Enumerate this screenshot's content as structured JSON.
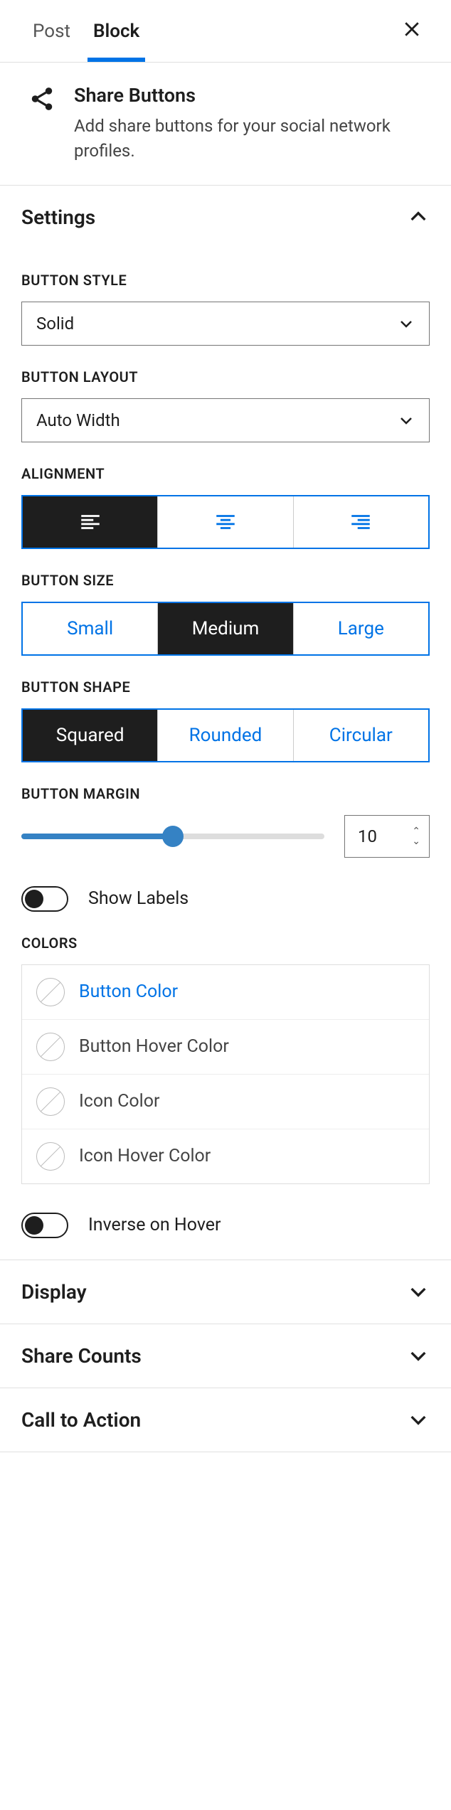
{
  "tabs": {
    "post": "Post",
    "block": "Block"
  },
  "block": {
    "title": "Share Buttons",
    "description": "Add share buttons for your social network profiles."
  },
  "panels": {
    "settings": "Settings",
    "display": "Display",
    "share_counts": "Share Counts",
    "cta": "Call to Action"
  },
  "settings": {
    "button_style": {
      "label": "BUTTON STYLE",
      "value": "Solid"
    },
    "button_layout": {
      "label": "BUTTON LAYOUT",
      "value": "Auto Width"
    },
    "alignment": {
      "label": "ALIGNMENT"
    },
    "button_size": {
      "label": "BUTTON SIZE",
      "options": [
        "Small",
        "Medium",
        "Large"
      ],
      "selected": "Medium"
    },
    "button_shape": {
      "label": "BUTTON SHAPE",
      "options": [
        "Squared",
        "Rounded",
        "Circular"
      ],
      "selected": "Squared"
    },
    "button_margin": {
      "label": "BUTTON MARGIN",
      "value": "10"
    },
    "show_labels": {
      "label": "Show Labels",
      "value": false
    },
    "colors": {
      "label": "COLORS",
      "items": [
        {
          "label": "Button Color",
          "active": true
        },
        {
          "label": "Button Hover Color",
          "active": false
        },
        {
          "label": "Icon Color",
          "active": false
        },
        {
          "label": "Icon Hover Color",
          "active": false
        }
      ]
    },
    "inverse_hover": {
      "label": "Inverse on Hover",
      "value": false
    }
  }
}
